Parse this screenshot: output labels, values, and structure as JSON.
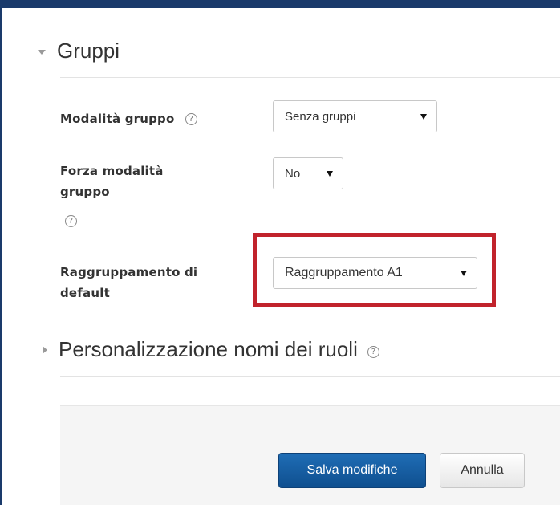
{
  "sections": {
    "gruppi": {
      "title": "Gruppi",
      "expanded": true
    },
    "ruoli": {
      "title": "Personalizzazione nomi dei ruoli",
      "expanded": false
    }
  },
  "fields": {
    "group_mode": {
      "label": "Modalità gruppo",
      "value": "Senza gruppi"
    },
    "force_group_mode": {
      "label_line1": "Forza modalità",
      "label_line2": "gruppo",
      "value": "No"
    },
    "default_grouping": {
      "label_line1": "Raggruppamento di",
      "label_line2": "default",
      "value": "Raggruppamento A1"
    }
  },
  "help_icon_glyph": "?",
  "icons": {
    "help": "help-icon",
    "expanded": "triangle-down-icon",
    "collapsed": "triangle-right-icon",
    "dropdown": "dropdown-arrow-icon"
  },
  "buttons": {
    "save": "Salva modifiche",
    "cancel": "Annulla"
  },
  "colors": {
    "frame": "#1a3a6b",
    "highlight": "#c1232c",
    "primary_button": "#15599e"
  }
}
